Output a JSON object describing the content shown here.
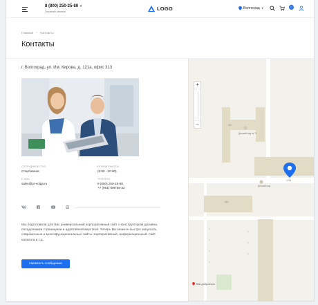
{
  "header": {
    "phone": "8 (800) 250-25-88",
    "callback": "Заказать звонок",
    "logo_text": "LOGO",
    "city": "Волгоград",
    "cart_count": "0"
  },
  "breadcrumb": [
    "Главная",
    "-",
    "Контакты"
  ],
  "page_title": "Контакты",
  "address": "г. Волгоград, ул. Им. Кирова, д. 121а, офис 313",
  "contacts": {
    "schedule_label": "Режим работы",
    "schedule_value": "(9:00 - 20:00)",
    "note_label": "Сотрудничество",
    "note_value": "Спортивная",
    "email_label": "E-mail",
    "email_value": "sales@pr-volga.ru",
    "phone_label": "Телефон",
    "phone_value_1": "8 (800) 250-25-88",
    "phone_value_2": "+7 (961) 606-58-32"
  },
  "socials": [
    "vk-icon",
    "facebook-icon",
    "youtube-icon",
    "instagram-icon"
  ],
  "description": "Мы подготовили для Вас универсальный корпоративный сайт с конструктором дизайна, посадочными страницами и адаптивной версткой. Теперь Вы можете быстро запускать современные и многофункциональные сайты: корпоративный, информационный, сайт каталога и т.д..",
  "button_label": "Написать сообщение",
  "map": {
    "labels": [
      "111",
      "Детский сад № 71",
      "121а",
      "Детский сад",
      "113",
      "Как добраться"
    ],
    "footer_text": "Как добраться"
  },
  "colors": {
    "accent": "#1d6ff0",
    "building": "#e2dcc7",
    "road": "#ffffff"
  }
}
